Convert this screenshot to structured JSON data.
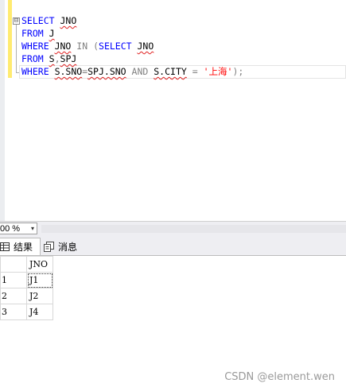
{
  "editor": {
    "fold_symbol": "⊟",
    "lines": {
      "l1": {
        "kw1": "SELECT",
        "ident1": "JNO"
      },
      "l2": {
        "kw1": "FROM",
        "ident1": "J"
      },
      "l3": {
        "kw1": "WHERE",
        "ident1": "JNO",
        "op1": "IN",
        "paren": "(",
        "kw2": "SELECT",
        "ident2": "JNO"
      },
      "l4": {
        "kw1": "FROM",
        "ident1": "S",
        "comma": ",",
        "ident2": "SPJ"
      },
      "l5": {
        "kw1": "WHERE",
        "ident1": "S.SNO",
        "eq": "=",
        "ident2": "SPJ.SNO",
        "op1": "AND",
        "ident3": "S.CITY",
        "eq2": "=",
        "str": "'上海'",
        "end": ");"
      }
    }
  },
  "zoom": {
    "value": "00 %",
    "arrow": "▾"
  },
  "tabs": {
    "results_label": "结果",
    "messages_label": "消息"
  },
  "results": {
    "column_header": "JNO",
    "rows": [
      {
        "num": "1",
        "jno": "J1"
      },
      {
        "num": "2",
        "jno": "J2"
      },
      {
        "num": "3",
        "jno": "J4"
      }
    ]
  },
  "watermark": "CSDN @element.wen",
  "colors": {
    "keyword": "#0000ff",
    "operator": "#808080",
    "string": "#ff0000",
    "change_bar": "#ffeb70"
  }
}
